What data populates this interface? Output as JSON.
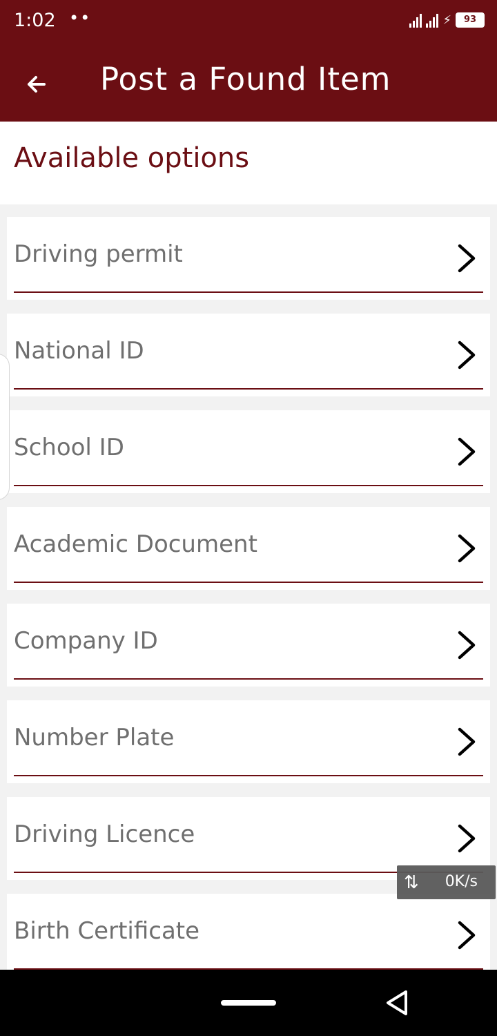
{
  "status": {
    "time": "1:02",
    "dots": "••",
    "battery": "93"
  },
  "header": {
    "title": "Post a Found Item"
  },
  "section": {
    "title": "Available options"
  },
  "options": [
    {
      "label": "Driving permit"
    },
    {
      "label": "National ID"
    },
    {
      "label": "School ID"
    },
    {
      "label": "Academic Document"
    },
    {
      "label": "Company ID"
    },
    {
      "label": "Number Plate"
    },
    {
      "label": "Driving Licence"
    },
    {
      "label": "Birth Certificate"
    }
  ],
  "overlay": {
    "speed": "0K/s"
  },
  "colors": {
    "primary": "#6b0e13",
    "background": "#f2f2f2",
    "option_text": "#6f6f6f"
  }
}
